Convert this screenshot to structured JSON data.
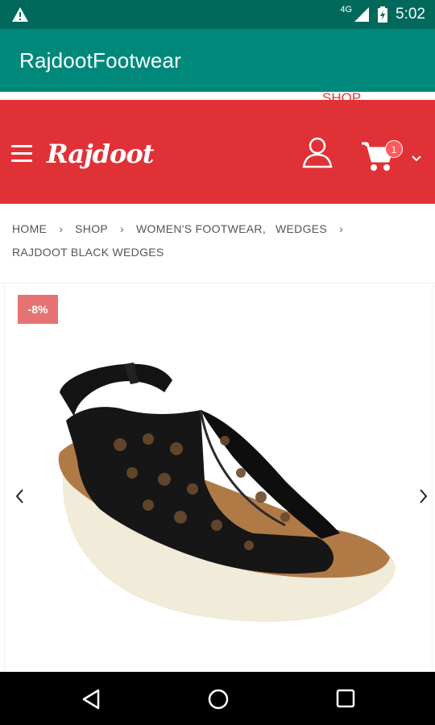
{
  "status_bar": {
    "network": "4G",
    "time": "5:02",
    "icons": [
      "warning-icon",
      "signal-icon",
      "battery-icon"
    ]
  },
  "app_bar": {
    "title": "RajdootFootwear"
  },
  "site_header": {
    "top_link_peek": "SHOP",
    "logo_text": "Rajdoot",
    "cart_count": "1",
    "colors": {
      "header_bg": "#e03236",
      "badge_bg": "#ff5a5f"
    }
  },
  "breadcrumb": {
    "home": "HOME",
    "shop": "SHOP",
    "category1": "WOMEN'S FOOTWEAR,",
    "category2": "WEDGES",
    "current": "RAJDOOT BLACK WEDGES"
  },
  "product": {
    "discount_badge": "-8%"
  },
  "nav_bar": {
    "icons": [
      "back-icon",
      "home-icon",
      "recents-icon"
    ]
  }
}
